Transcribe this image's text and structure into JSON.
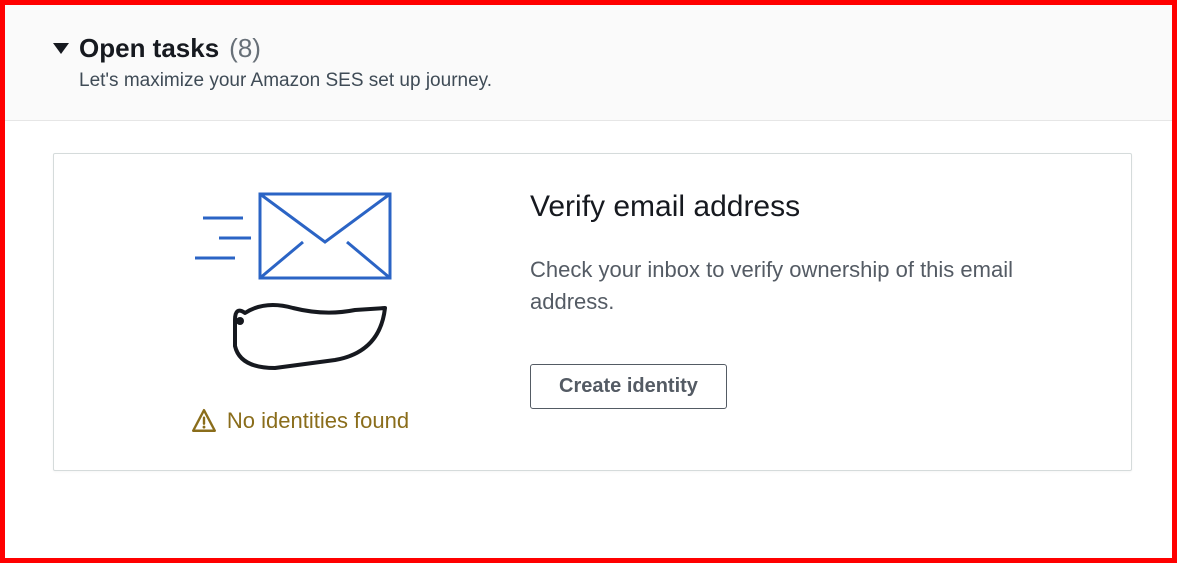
{
  "header": {
    "title": "Open tasks",
    "count": "(8)",
    "subtitle": "Let's maximize your Amazon SES set up journey."
  },
  "card": {
    "status_text": "No identities found",
    "title": "Verify email address",
    "description": "Check your inbox to verify ownership of this email address.",
    "button_label": "Create identity"
  },
  "icons": {
    "caret": "caret-down",
    "warning": "warning-triangle",
    "illustration": "hand-envelope"
  }
}
